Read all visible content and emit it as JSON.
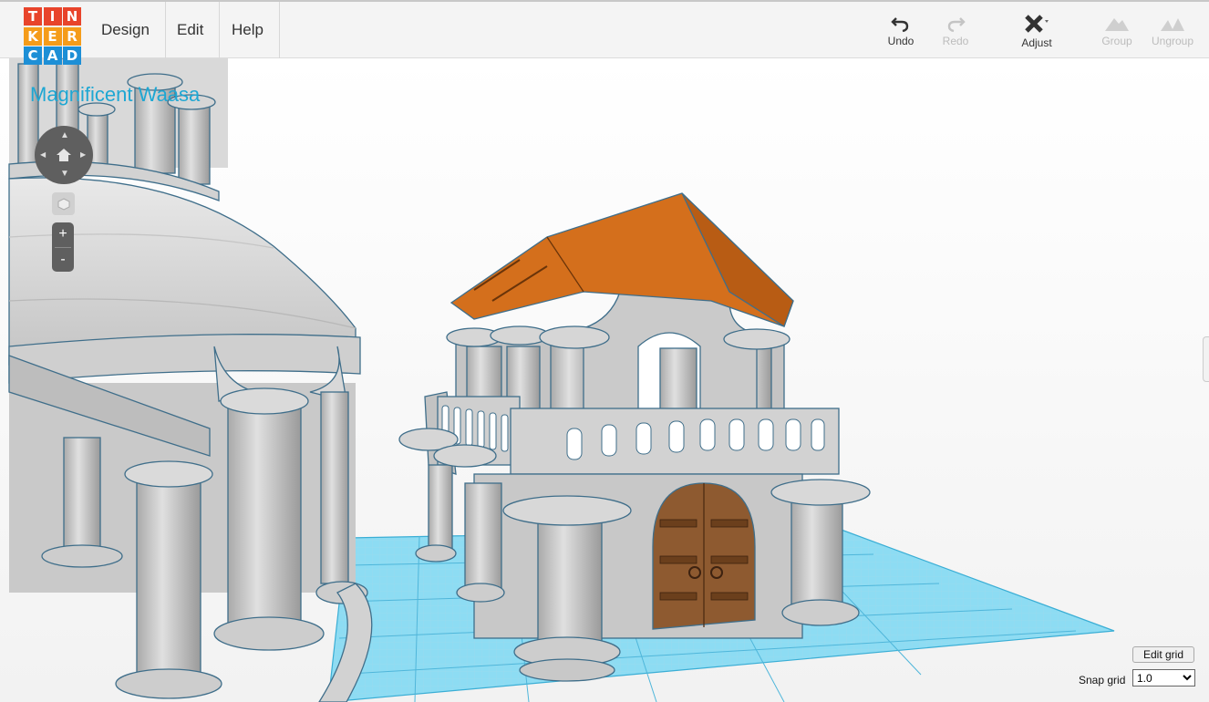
{
  "logo": {
    "letters": [
      "T",
      "I",
      "N",
      "K",
      "E",
      "R",
      "C",
      "A",
      "D"
    ]
  },
  "menu": {
    "design": "Design",
    "edit": "Edit",
    "help": "Help"
  },
  "toolbar": {
    "undo": "Undo",
    "redo": "Redo",
    "adjust": "Adjust",
    "group": "Group",
    "ungroup": "Ungroup"
  },
  "design_title": "Magnificent Waasa",
  "nav": {
    "zoom_in": "+",
    "zoom_out": "-"
  },
  "grid": {
    "edit_label": "Edit grid",
    "snap_label": "Snap grid",
    "snap_value": "1.0"
  },
  "colors": {
    "accent": "#1ea7d3",
    "roof": "#d46f1c",
    "door": "#8e5a30",
    "workplane": "#7fd6f0"
  }
}
